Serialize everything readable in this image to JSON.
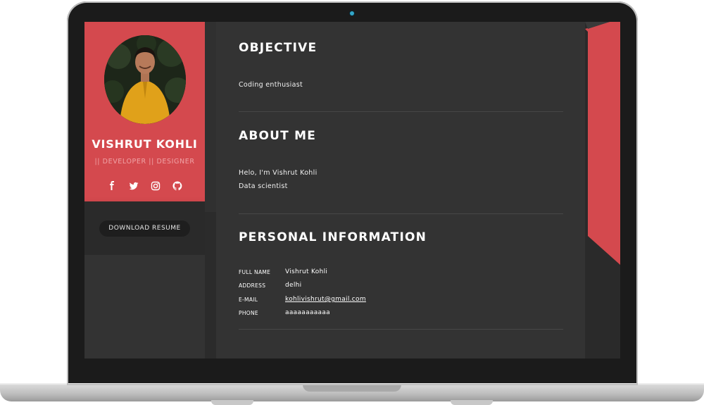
{
  "profile": {
    "name": "VISHRUT KOHLI",
    "role": "|| DEVELOPER || DESIGNER",
    "download_label": "DOWNLOAD RESUME",
    "socials": [
      "facebook-icon",
      "twitter-icon",
      "instagram-icon",
      "github-icon"
    ]
  },
  "objective": {
    "title": "OBJECTIVE",
    "text": "Coding enthusiast"
  },
  "about": {
    "title": "ABOUT ME",
    "lines": [
      "Helo, I'm Vishrut Kohli",
      "Data scientist"
    ]
  },
  "personal": {
    "title": "PERSONAL INFORMATION",
    "rows": [
      {
        "label": "FULL NAME",
        "value": "Vishrut Kohli"
      },
      {
        "label": "ADDRESS",
        "value": "delhi"
      },
      {
        "label": "E-MAIL",
        "value": "kohlivishrut@gmail.com"
      },
      {
        "label": "PHONE",
        "value": "aaaaaaaaaaa"
      }
    ]
  },
  "colors": {
    "accent": "#d4494e",
    "background": "#333333",
    "sidebar_dark": "#2a2a2a",
    "button": "#1e1e1e",
    "camera": "#33a6c8"
  }
}
